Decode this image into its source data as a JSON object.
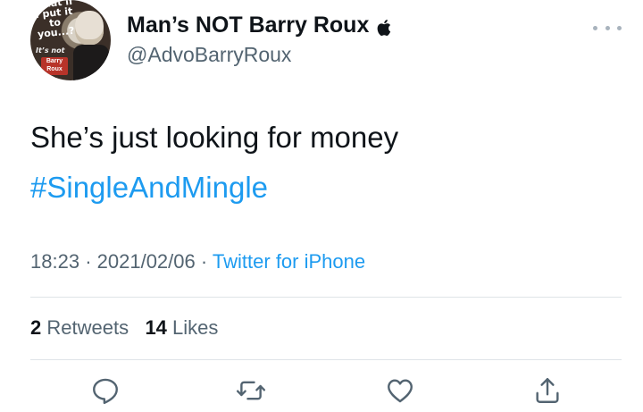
{
  "author": {
    "display_name": "Man’s NOT Barry Roux",
    "handle": "@AdvoBarryRoux",
    "avatar_text": "What if I put it to you...?",
    "avatar_subtext": "It’s not",
    "avatar_stamp": "Barry Roux"
  },
  "tweet": {
    "text": "She’s just looking for money",
    "hashtag": "#SingleAndMingle",
    "time": "18:23",
    "date": "2021/02/06",
    "separator": "·",
    "source": "Twitter for iPhone"
  },
  "stats": {
    "retweets_count": "2",
    "retweets_label": "Retweets",
    "likes_count": "14",
    "likes_label": "Likes"
  },
  "icons": {
    "verified_badge": "apple-icon",
    "more": "more-icon",
    "reply": "reply-icon",
    "retweet": "retweet-icon",
    "like": "heart-icon",
    "share": "share-icon"
  },
  "colors": {
    "accent": "#1d9bf0",
    "secondary_text": "#536471",
    "primary_text": "#0f1419",
    "divider": "#dfe4e8"
  }
}
